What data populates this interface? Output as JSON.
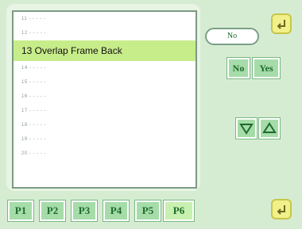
{
  "list": {
    "items": [
      {
        "label": "11 - - - - -"
      },
      {
        "label": "12 - - - - -"
      },
      {
        "label": "13 Overlap Frame Back",
        "selected": true
      },
      {
        "label": "14 - - - - -"
      },
      {
        "label": "15 - - - - -"
      },
      {
        "label": "16 - - - - -"
      },
      {
        "label": "17 - - - - -"
      },
      {
        "label": "18 - - - - -"
      },
      {
        "label": "19 - - - - -"
      },
      {
        "label": "20 - - - - -"
      }
    ]
  },
  "value_box": {
    "text": "No"
  },
  "buttons": {
    "no": "No",
    "yes": "Yes"
  },
  "tabs": [
    "P1",
    "P2",
    "P3",
    "P4",
    "P5",
    "P6"
  ],
  "active_tab": "P6",
  "icons": {
    "top_right": "back-arrow-icon",
    "bottom_right": "enter-arrow-icon",
    "down": "triangle-down-icon",
    "up": "triangle-up-icon"
  }
}
